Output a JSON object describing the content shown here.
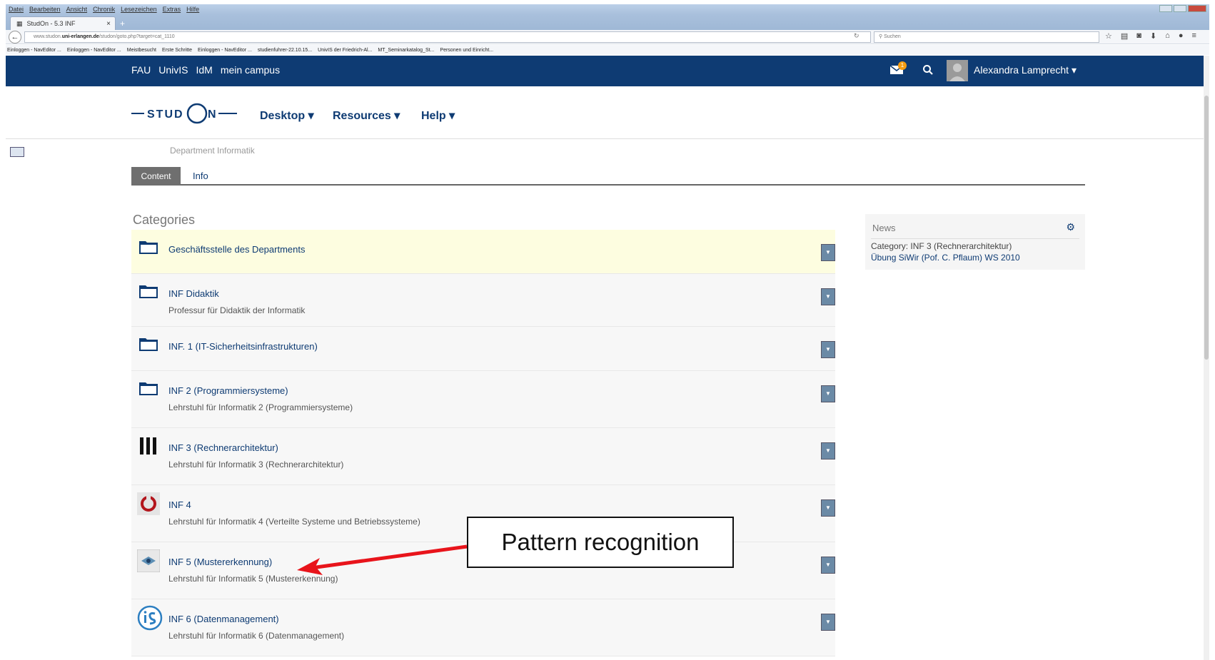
{
  "browser": {
    "menu": [
      "Datei",
      "Bearbeiten",
      "Ansicht",
      "Chronik",
      "Lesezeichen",
      "Extras",
      "Hilfe"
    ],
    "tab_title": "StudOn - 5.3 INF",
    "url_prefix": "www.studon.",
    "url_domain": "uni-erlangen.de",
    "url_path": "/studon/goto.php?target=cat_1110",
    "search_placeholder": "Suchen",
    "bookmarks": [
      "Einloggen - NavEditor ...",
      "Einloggen - NavEditor ...",
      "Meistbesucht",
      "Erste Schritte",
      "Einloggen - NavEditor ...",
      "studienfuhrer-22.10.15...",
      "UnivIS der Friedrich-Al...",
      "MT_Seminarkatalog_St...",
      "Personen und Einricht..."
    ]
  },
  "header": {
    "links": [
      "FAU",
      "UnivIS",
      "IdM",
      "mein campus"
    ],
    "mail_badge": "1",
    "user_name": "Alexandra Lamprecht"
  },
  "nav": {
    "logo_text": "STUD",
    "logo_text2": "N",
    "items": [
      "Desktop",
      "Resources",
      "Help"
    ]
  },
  "breadcrumb_dept": "Department Informatik",
  "tabs": {
    "content": "Content",
    "info": "Info"
  },
  "categories_heading": "Categories",
  "categories": [
    {
      "title": "Geschäftsstelle des Departments",
      "desc": "",
      "icon": "folder-icon"
    },
    {
      "title": "INF Didaktik",
      "desc": "Professur für Didaktik der Informatik",
      "icon": "folder-icon"
    },
    {
      "title": "INF. 1 (IT-Sicherheitsinfrastrukturen)",
      "desc": "",
      "icon": "folder-icon"
    },
    {
      "title": "INF 2 (Programmiersysteme)",
      "desc": "Lehrstuhl für Informatik 2 (Programmiersysteme)",
      "icon": "folder-icon"
    },
    {
      "title": "INF 3 (Rechnerarchitektur)",
      "desc": "Lehrstuhl für Informatik 3 (Rechnerarchitektur)",
      "icon": "three-bars-icon"
    },
    {
      "title": "INF 4",
      "desc": "Lehrstuhl für Informatik 4 (Verteilte Systeme und Betriebssysteme)",
      "icon": "ring-logo-icon"
    },
    {
      "title": "INF 5 (Mustererkennung)",
      "desc": "Lehrstuhl für Informatik 5 (Mustererkennung)",
      "icon": "lme-logo-icon"
    },
    {
      "title": "INF 6 (Datenmanagement)",
      "desc": "Lehrstuhl für Informatik 6 (Datenmanagement)",
      "icon": "is-logo-icon"
    }
  ],
  "news": {
    "heading": "News",
    "category": "Category: INF 3 (Rechnerarchitektur)",
    "link": "Übung SiWir (Pof. C. Pflaum) WS 2010"
  },
  "annotation": "Pattern recognition",
  "colors": {
    "brand_blue": "#0e3b73",
    "highlight_row": "#fdfde0",
    "arrow_red": "#e8141b"
  }
}
